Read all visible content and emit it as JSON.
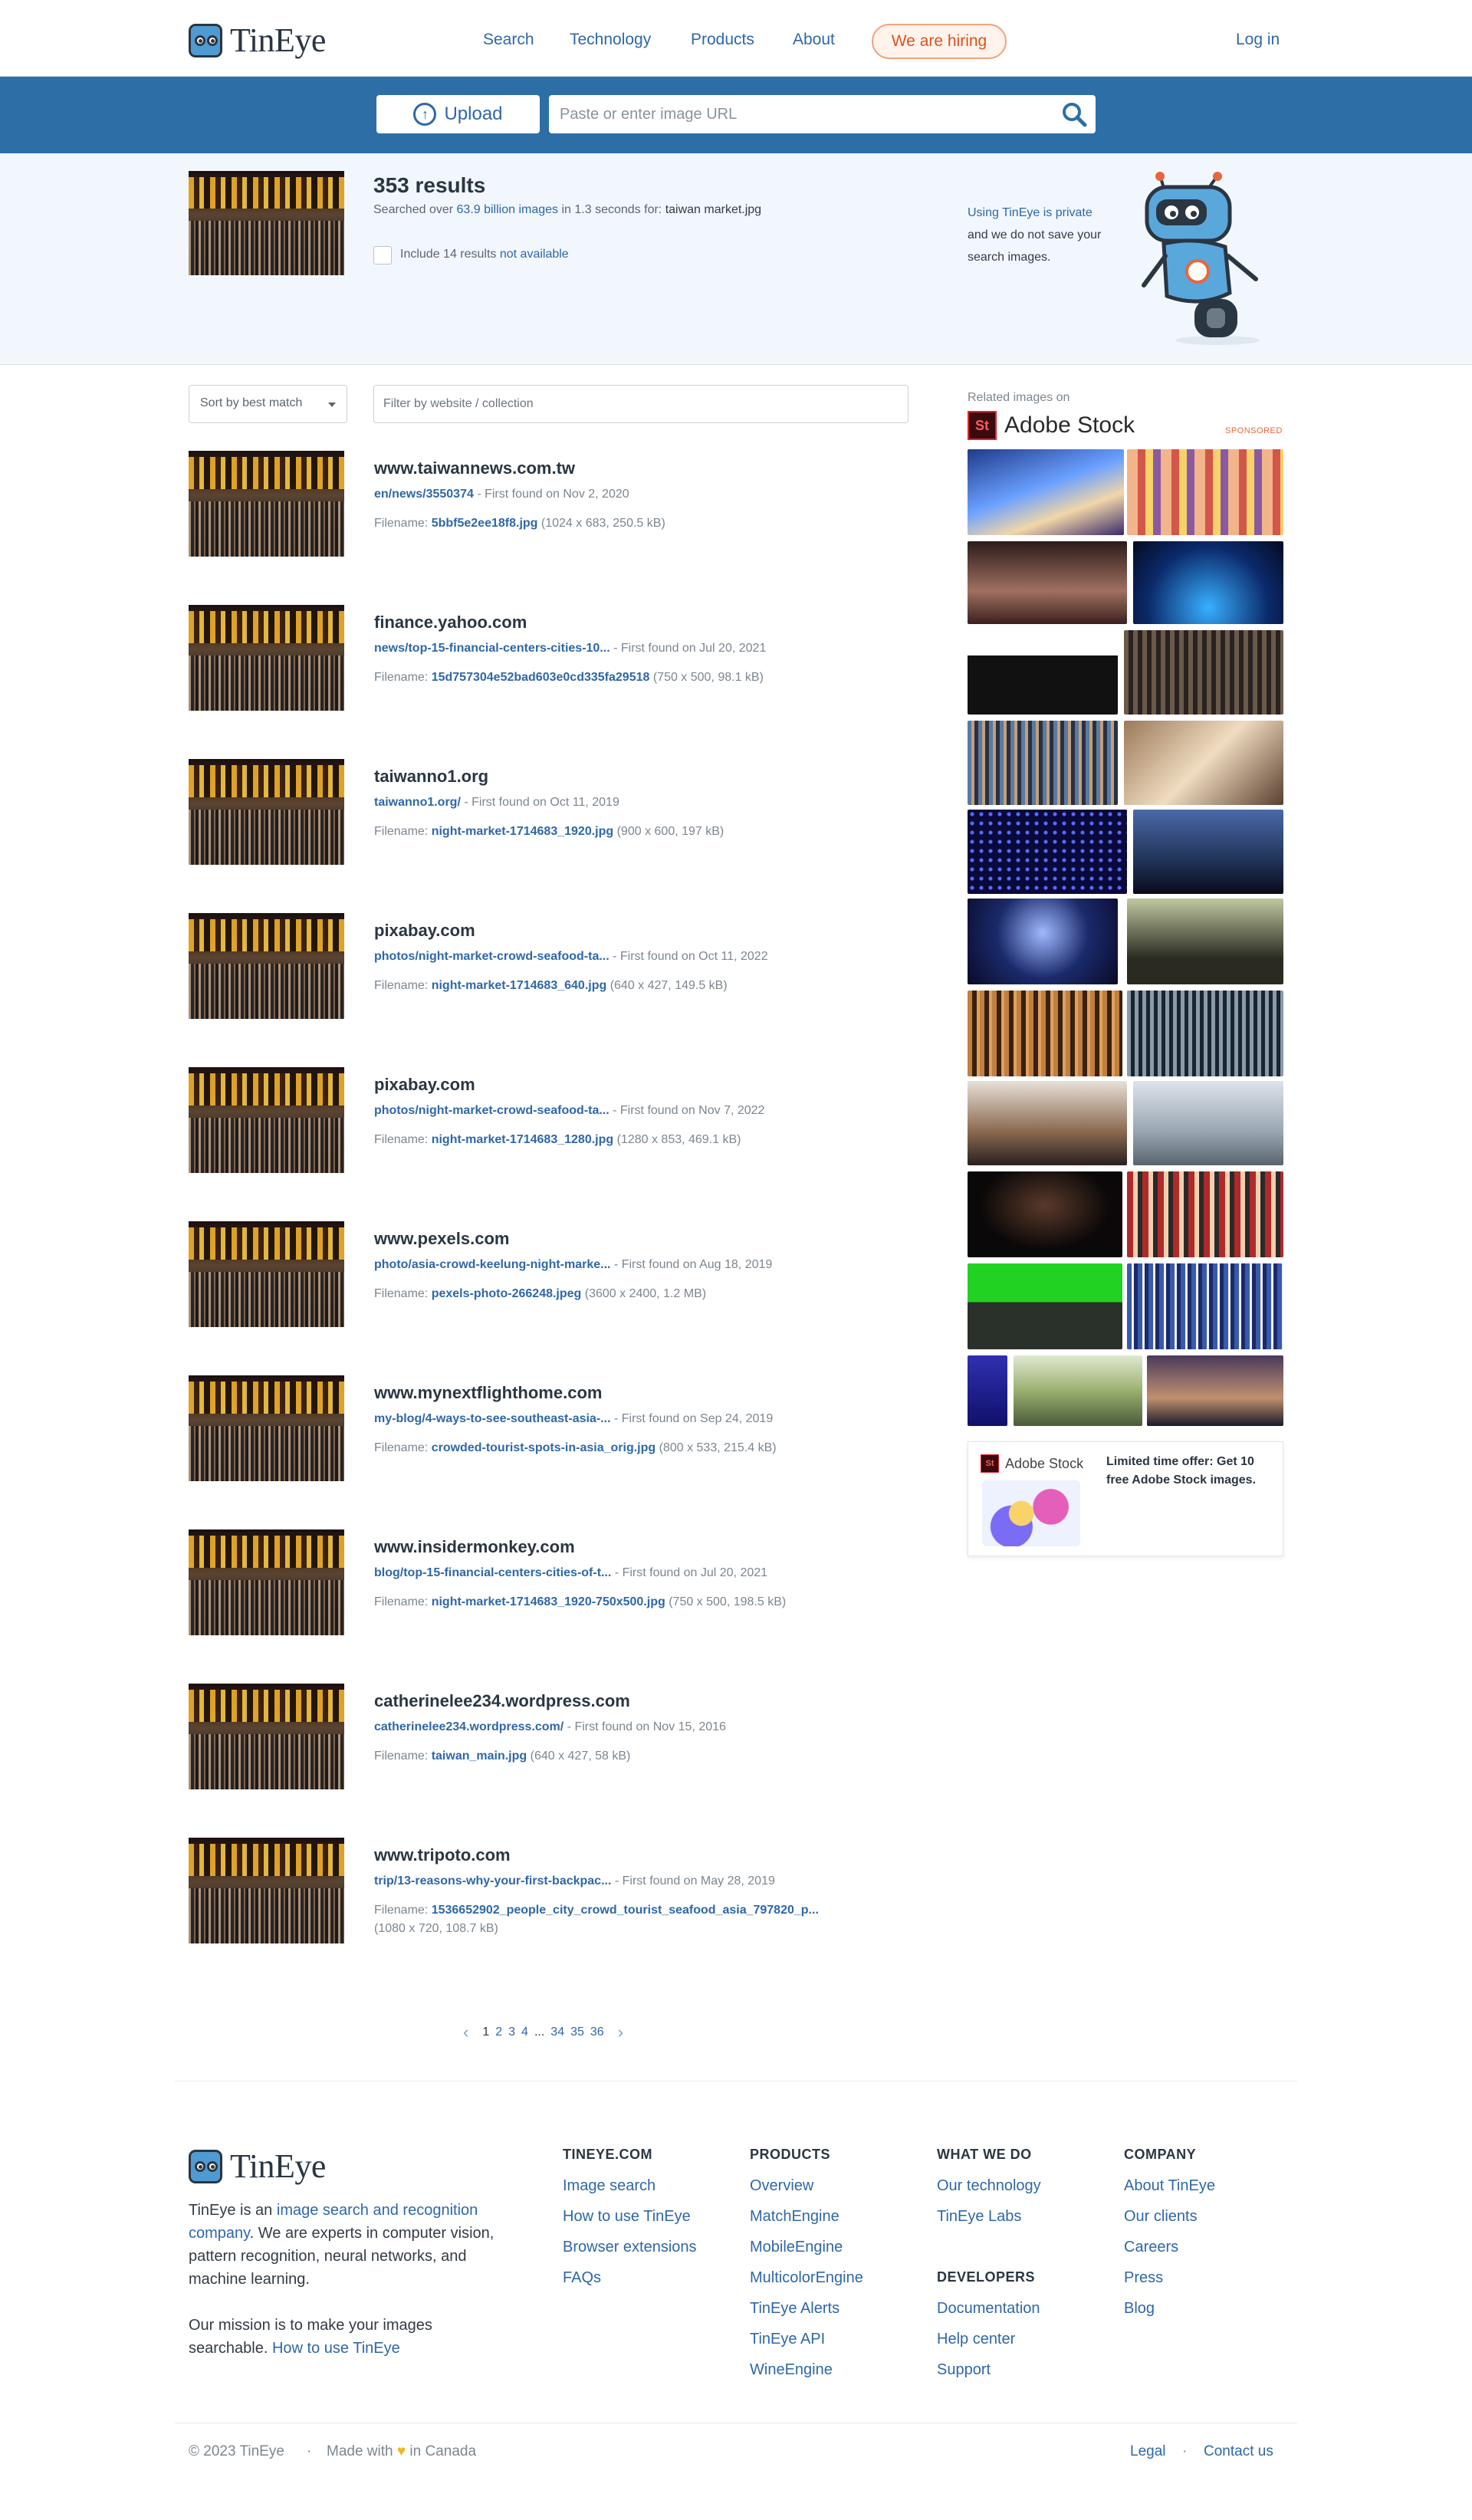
{
  "header": {
    "logo_text": "TinEye",
    "nav": [
      "Search",
      "Technology",
      "Products",
      "About"
    ],
    "hiring": "We are hiring",
    "login": "Log in"
  },
  "search": {
    "upload_label": "Upload",
    "url_placeholder": "Paste or enter image URL"
  },
  "summary": {
    "count": "353 results",
    "searched_prefix": "Searched over ",
    "searched_link": "63.9 billion images",
    "searched_suffix": " in 1.3 seconds for: ",
    "filename": "taiwan market.jpg",
    "include_prefix": "Include 14 results ",
    "include_link": "not available",
    "privacy_link": "Using TinEye is private",
    "privacy_rest": "and we do not save your search images."
  },
  "controls": {
    "sort_label": "Sort by best match",
    "filter_placeholder": "Filter by website / collection"
  },
  "labels": {
    "first_found": " - First found on ",
    "filename": "Filename: "
  },
  "results": [
    {
      "site": "www.taiwannews.com.tw",
      "path": "en/news/3550374",
      "date": "Nov 2, 2020",
      "file": "5bbf5e2ee18f8.jpg",
      "dims": " (1024 x 683, 250.5 kB)",
      "dims2": ""
    },
    {
      "site": "finance.yahoo.com",
      "path": "news/top-15-financial-centers-cities-10...",
      "date": "Jul 20, 2021",
      "file": "15d757304e52bad603e0cd335fa29518",
      "dims": " (750 x 500, 98.1 kB)",
      "dims2": ""
    },
    {
      "site": "taiwanno1.org",
      "path": "taiwanno1.org/",
      "date": "Oct 11, 2019",
      "file": "night-market-1714683_1920.jpg",
      "dims": " (900 x 600, 197 kB)",
      "dims2": ""
    },
    {
      "site": "pixabay.com",
      "path": "photos/night-market-crowd-seafood-ta...",
      "date": "Oct 11, 2022",
      "file": "night-market-1714683_640.jpg",
      "dims": " (640 x 427, 149.5 kB)",
      "dims2": ""
    },
    {
      "site": "pixabay.com",
      "path": "photos/night-market-crowd-seafood-ta...",
      "date": "Nov 7, 2022",
      "file": "night-market-1714683_1280.jpg",
      "dims": " (1280 x 853, 469.1 kB)",
      "dims2": ""
    },
    {
      "site": "www.pexels.com",
      "path": "photo/asia-crowd-keelung-night-marke...",
      "date": "Aug 18, 2019",
      "file": "pexels-photo-266248.jpeg",
      "dims": " (3600 x 2400, 1.2 MB)",
      "dims2": ""
    },
    {
      "site": "www.mynextflighthome.com",
      "path": "my-blog/4-ways-to-see-southeast-asia-...",
      "date": "Sep 24, 2019",
      "file": "crowded-tourist-spots-in-asia_orig.jpg",
      "dims": " (800 x 533, 215.4 kB)",
      "dims2": ""
    },
    {
      "site": "www.insidermonkey.com",
      "path": "blog/top-15-financial-centers-cities-of-t...",
      "date": "Jul 20, 2021",
      "file": "night-market-1714683_1920-750x500.jpg",
      "dims": " (750 x 500, 198.5 kB)",
      "dims2": ""
    },
    {
      "site": "catherinelee234.wordpress.com",
      "path": "catherinelee234.wordpress.com/",
      "date": "Nov 15, 2016",
      "file": "taiwan_main.jpg",
      "dims": " (640 x 427, 58 kB)",
      "dims2": ""
    },
    {
      "site": "www.tripoto.com",
      "path": "trip/13-reasons-why-your-first-backpac...",
      "date": "May 28, 2019",
      "file": "1536652902_people_city_crowd_tourist_seafood_asia_797820_p...",
      "dims": "",
      "dims2": "(1080 x 720, 108.7 kB)"
    }
  ],
  "sidebar": {
    "related_label": "Related images on",
    "brand_mark": "St",
    "brand": "Adobe Stock",
    "sponsored": "SPONSORED",
    "offer_brand": "Adobe Stock",
    "offer_text": "Limited time offer: Get 10 free Adobe Stock images."
  },
  "pagination": {
    "pages": [
      "1",
      "2",
      "3",
      "4",
      "...",
      "34",
      "35",
      "36"
    ],
    "current": "1"
  },
  "footer": {
    "desc_prefix": "TinEye is an ",
    "desc_link": "image search and recognition company",
    "desc_suffix": ". We are experts in computer vision, pattern recognition, neural networks, and machine learning.",
    "mission_prefix": "Our mission is to make your images searchable. ",
    "mission_link": "How to use TinEye",
    "col1_head": "TINEYE.COM",
    "col1": [
      "Image search",
      "How to use TinEye",
      "Browser extensions",
      "FAQs"
    ],
    "col2_head": "PRODUCTS",
    "col2": [
      "Overview",
      "MatchEngine",
      "MobileEngine",
      "MulticolorEngine",
      "TinEye Alerts",
      "TinEye API",
      "WineEngine"
    ],
    "col3_head": "WHAT WE DO",
    "col3": [
      "Our technology",
      "TinEye Labs"
    ],
    "col3b_head": "DEVELOPERS",
    "col3b": [
      "Documentation",
      "Help center",
      "Support"
    ],
    "col4_head": "COMPANY",
    "col4": [
      "About TinEye",
      "Our clients",
      "Careers",
      "Press",
      "Blog"
    ],
    "copyright": "© 2023 TinEye",
    "made_prefix": "Made with ",
    "made_suffix": " in Canada",
    "legal": "Legal",
    "contact": "Contact us"
  },
  "colors": {
    "brand_blue": "#2e6ea6",
    "link": "#2f67a8",
    "hiring_orange": "#d9521d",
    "sponsored": "#e8663d"
  }
}
